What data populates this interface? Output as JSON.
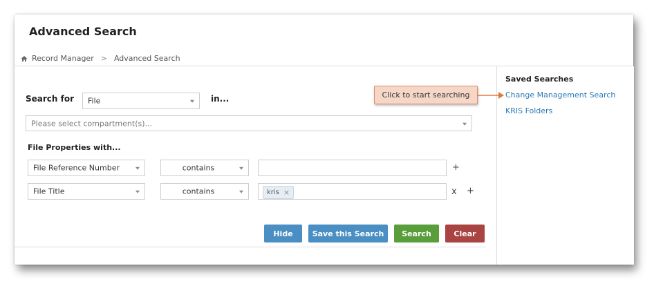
{
  "header": {
    "title": "Advanced Search"
  },
  "breadcrumb": {
    "items": [
      "Record Manager",
      "Advanced Search"
    ],
    "separator": ">"
  },
  "search": {
    "search_for_label": "Search for",
    "type_value": "File",
    "in_label": "in...",
    "compartment_placeholder": "Please select compartment(s)..."
  },
  "file_properties": {
    "label": "File Properties with...",
    "rows": [
      {
        "field": "File Reference Number",
        "operator": "contains",
        "value": "",
        "actions": [
          "+"
        ]
      },
      {
        "field": "File Title",
        "operator": "contains",
        "tags": [
          "kris"
        ],
        "tag_remove": "×",
        "actions": [
          "x",
          "+"
        ]
      }
    ]
  },
  "buttons": {
    "hide": "Hide",
    "save": "Save this Search",
    "search": "Search",
    "clear": "Clear"
  },
  "saved_searches": {
    "title": "Saved Searches",
    "items": [
      "Change Management Search",
      "KRIS Folders"
    ]
  },
  "callout": {
    "text": "Click to start searching"
  },
  "colors": {
    "hide_button": "#4a8fc4",
    "save_button": "#4a8fc4",
    "search_button": "#5a9e3c",
    "clear_button": "#a94442",
    "link": "#2a7ab8",
    "callout_bg": "#f6d6c7",
    "callout_arrow": "#e07a3c"
  }
}
